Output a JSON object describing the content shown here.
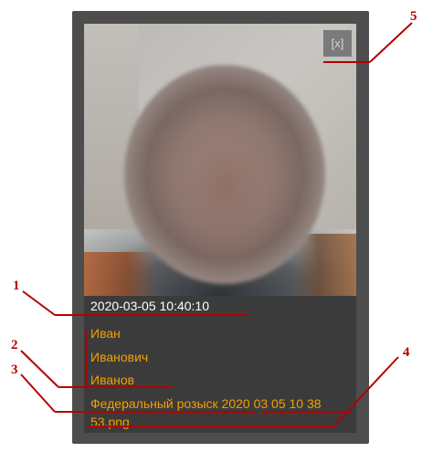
{
  "card": {
    "close_label": "[x]",
    "timestamp": "2020-03-05 10:40:10",
    "name": {
      "first": "Иван",
      "middle": "Иванович",
      "last": "Иванов"
    },
    "list_name": "Федеральный розыск",
    "file_name": "2020 03 05 10 38 53.png"
  },
  "annotation_markers": [
    "1",
    "2",
    "3",
    "4",
    "5"
  ],
  "colors": {
    "card_background": "#4d4d4d",
    "info_background": "#3b3b3b",
    "name_text": "#f2a100",
    "timestamp_text": "#ffffff",
    "annotation": "#b40000"
  },
  "icons": {
    "close": "close-icon"
  }
}
